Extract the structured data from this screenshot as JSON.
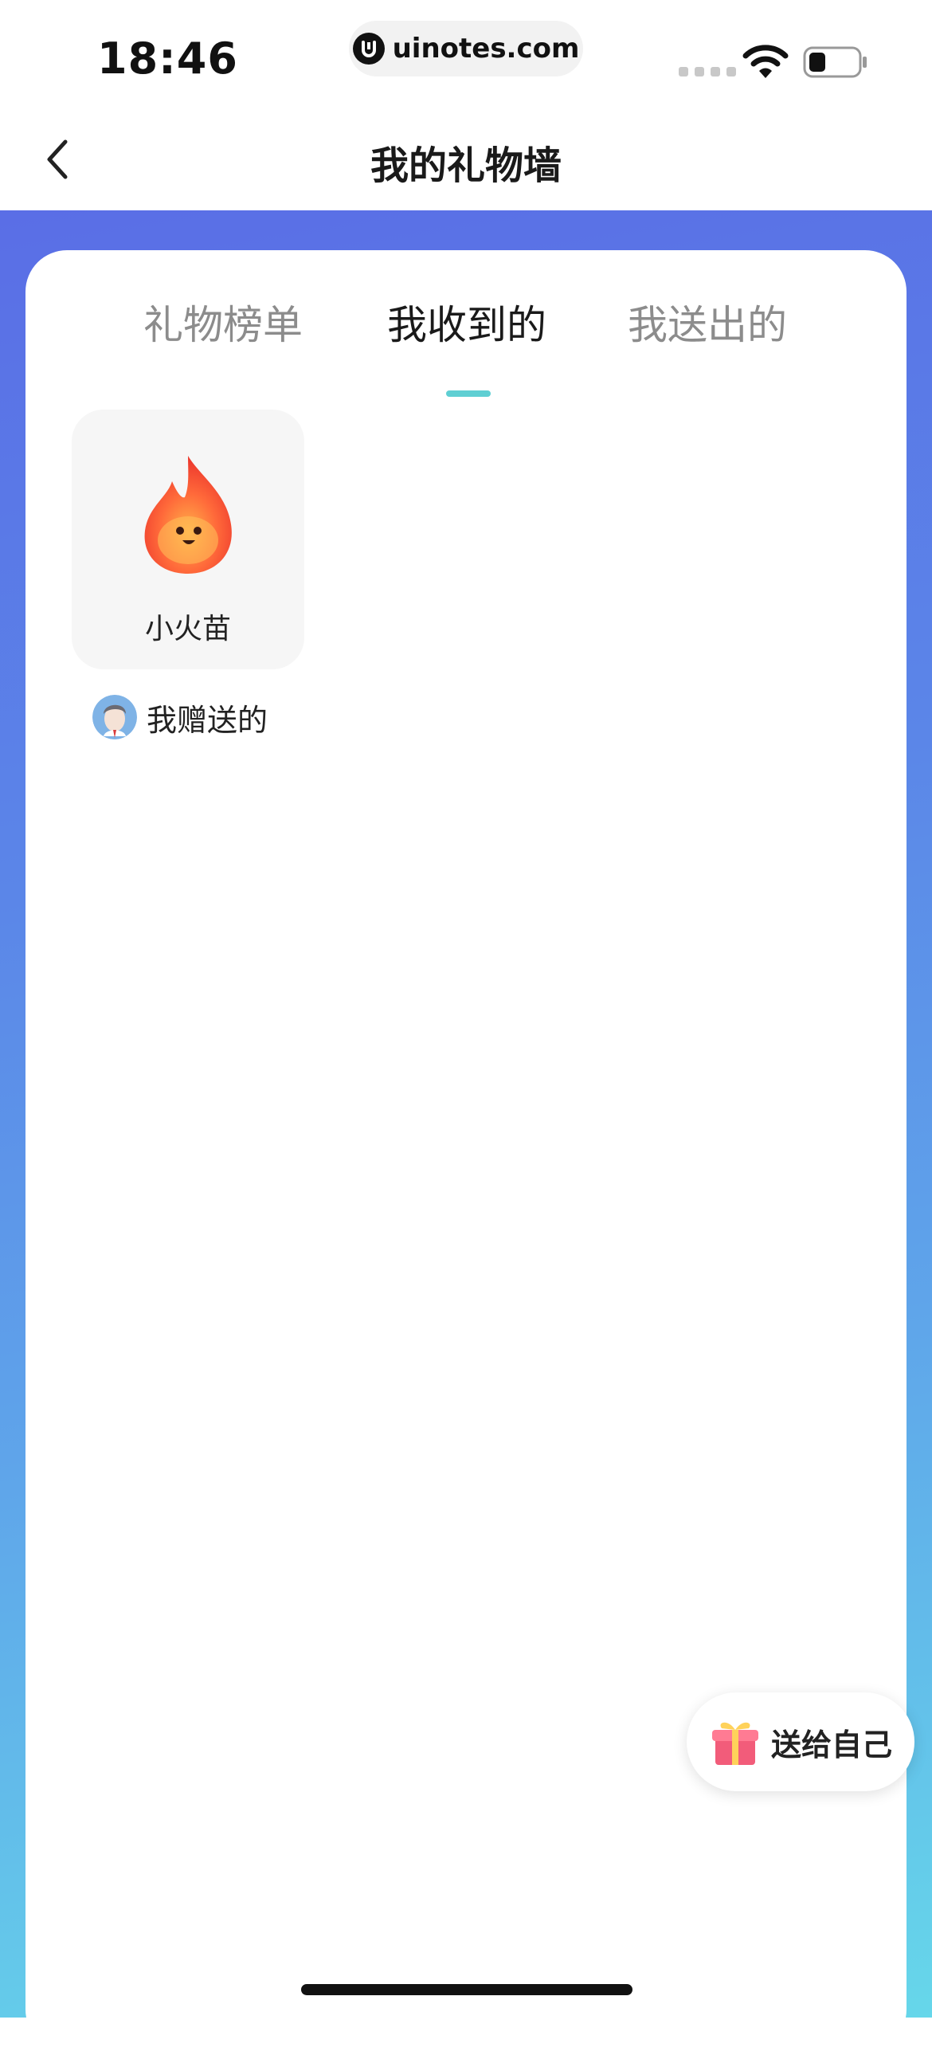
{
  "status_bar": {
    "time": "18:46",
    "url": "uinotes.com"
  },
  "nav": {
    "title": "我的礼物墙"
  },
  "tabs": [
    {
      "label": "礼物榜单",
      "active": false
    },
    {
      "label": "我收到的",
      "active": true
    },
    {
      "label": "我送出的",
      "active": false
    }
  ],
  "gifts": [
    {
      "name": "小火苗",
      "icon": "flame-icon",
      "sender_label": "我赠送的"
    }
  ],
  "actions": {
    "gift_self_label": "送给自己"
  },
  "colors": {
    "tab_underline": "#5fcfd3",
    "gradient_top": "#5a6ee6",
    "gradient_bottom": "#66d7ea"
  }
}
